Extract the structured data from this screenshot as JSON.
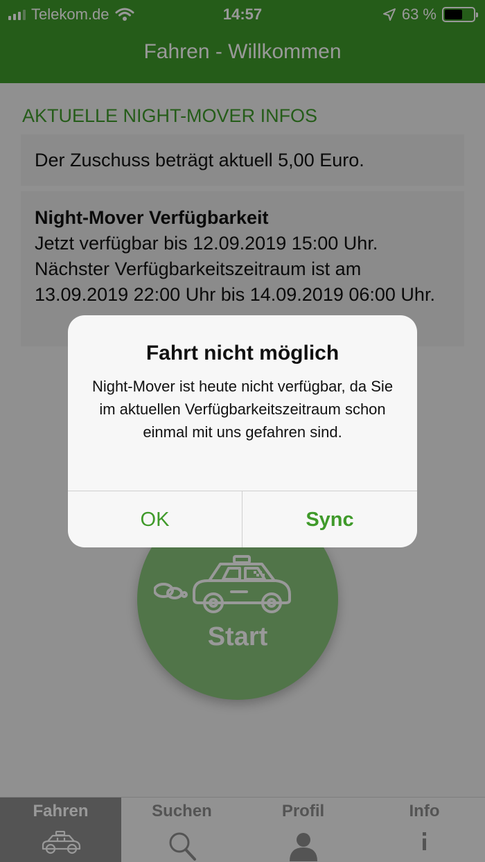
{
  "status_bar": {
    "carrier": "Telekom.de",
    "time": "14:57",
    "battery": "63 %",
    "battery_level": 0.63
  },
  "nav": {
    "title": "Fahren - Willkommen"
  },
  "infos": {
    "section_title": "AKTUELLE NIGHT-MOVER INFOS",
    "subsidy_text": "Der Zuschuss beträgt aktuell 5,00 Euro.",
    "availability_title": "Night-Mover Verfügbarkeit",
    "availability_text": "Jetzt verfügbar bis 12.09.2019 15:00 Uhr. Nächster Verfügbarkeitszeitraum ist am 13.09.2019 22:00 Uhr bis 14.09.2019 06:00 Uhr."
  },
  "start_button": {
    "label": "Start",
    "icon": "taxi-icon"
  },
  "tabs": [
    {
      "label": "Fahren",
      "icon": "taxi-icon",
      "active": true
    },
    {
      "label": "Suchen",
      "icon": "search-icon",
      "active": false
    },
    {
      "label": "Profil",
      "icon": "person-icon",
      "active": false
    },
    {
      "label": "Info",
      "icon": "info-icon",
      "active": false
    }
  ],
  "alert": {
    "title": "Fahrt nicht möglich",
    "message": "Night-Mover ist heute nicht verfügbar, da Sie im aktuellen Verfügbarkeitszeitraum schon einmal mit uns gefahren sind.",
    "ok_label": "OK",
    "sync_label": "Sync"
  },
  "colors": {
    "brand_green": "#3f9a2a",
    "start_green": "#87c47b",
    "card_gray": "#e8e8e8",
    "tab_active": "#8c8c8c"
  }
}
